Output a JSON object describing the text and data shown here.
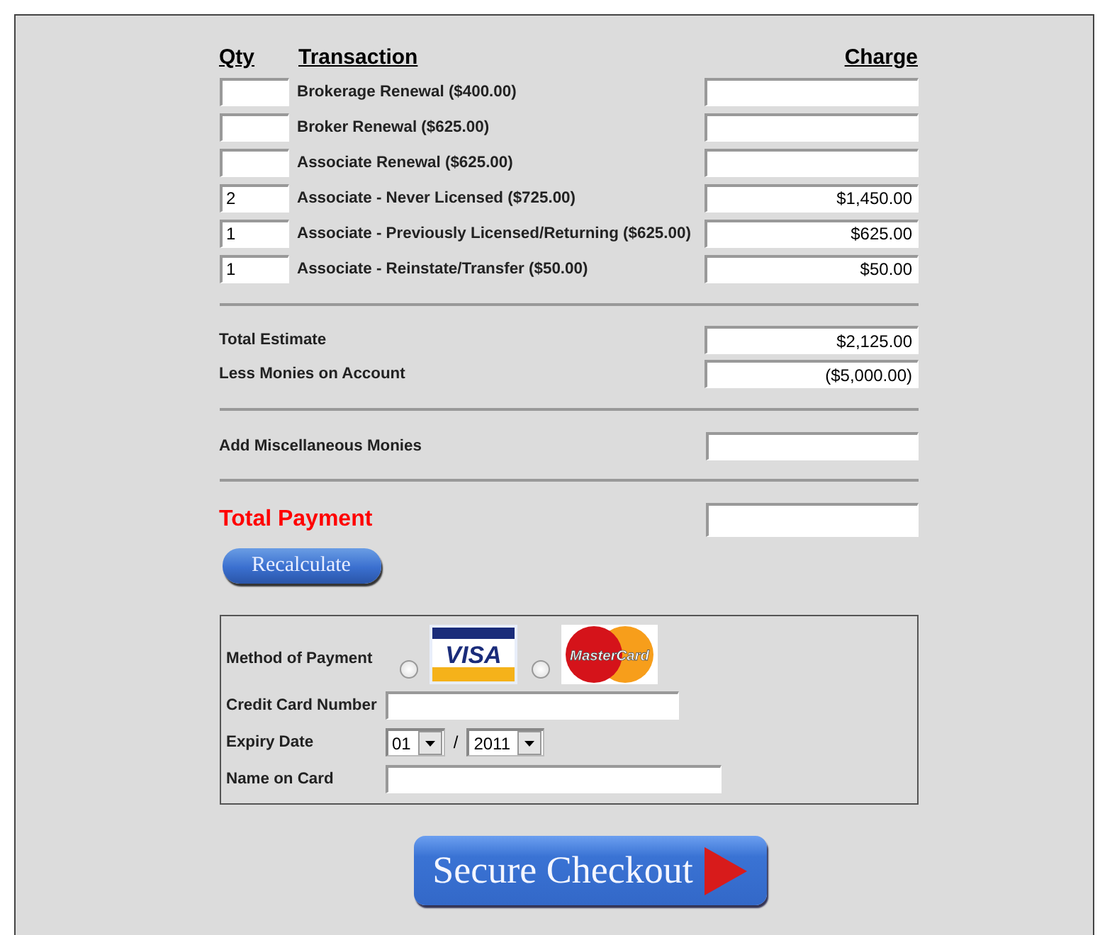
{
  "table": {
    "columns": [
      "Qty",
      "Transaction",
      "Charge"
    ],
    "rows": [
      {
        "qty": "",
        "transaction": "Brokerage Renewal ($400.00)",
        "charge": ""
      },
      {
        "qty": "",
        "transaction": "Broker Renewal ($625.00)",
        "charge": ""
      },
      {
        "qty": "",
        "transaction": "Associate Renewal ($625.00)",
        "charge": ""
      },
      {
        "qty": "2",
        "transaction": "Associate - Never Licensed ($725.00)",
        "charge": "$1,450.00"
      },
      {
        "qty": "1",
        "transaction": "Associate - Previously Licensed/Returning ($625.00)",
        "charge": "$625.00"
      },
      {
        "qty": "1",
        "transaction": "Associate - Reinstate/Transfer ($50.00)",
        "charge": "$50.00"
      }
    ]
  },
  "summary": [
    {
      "label": "Total Estimate",
      "value": "$2,125.00"
    },
    {
      "label": "Less Monies on Account",
      "value": "($5,000.00)"
    }
  ],
  "misc": {
    "label": "Add Miscellaneous Monies"
  },
  "total": {
    "label": "Total Payment"
  },
  "recalculate_button": "Recalculate",
  "payment": {
    "method_label": "Method of Payment",
    "methods": [
      {
        "kind": "visa",
        "logo_text": "VISA",
        "selected": false
      },
      {
        "kind": "mastercard",
        "logo_text": "MasterCard",
        "selected": false
      }
    ],
    "card_number_label": "Credit Card Number",
    "expiry_label": "Expiry Date",
    "expiry_month": "01",
    "expiry_separator": "/",
    "expiry_year": "2011",
    "name_label": "Name on Card"
  },
  "checkout_button": "Secure Checkout"
}
